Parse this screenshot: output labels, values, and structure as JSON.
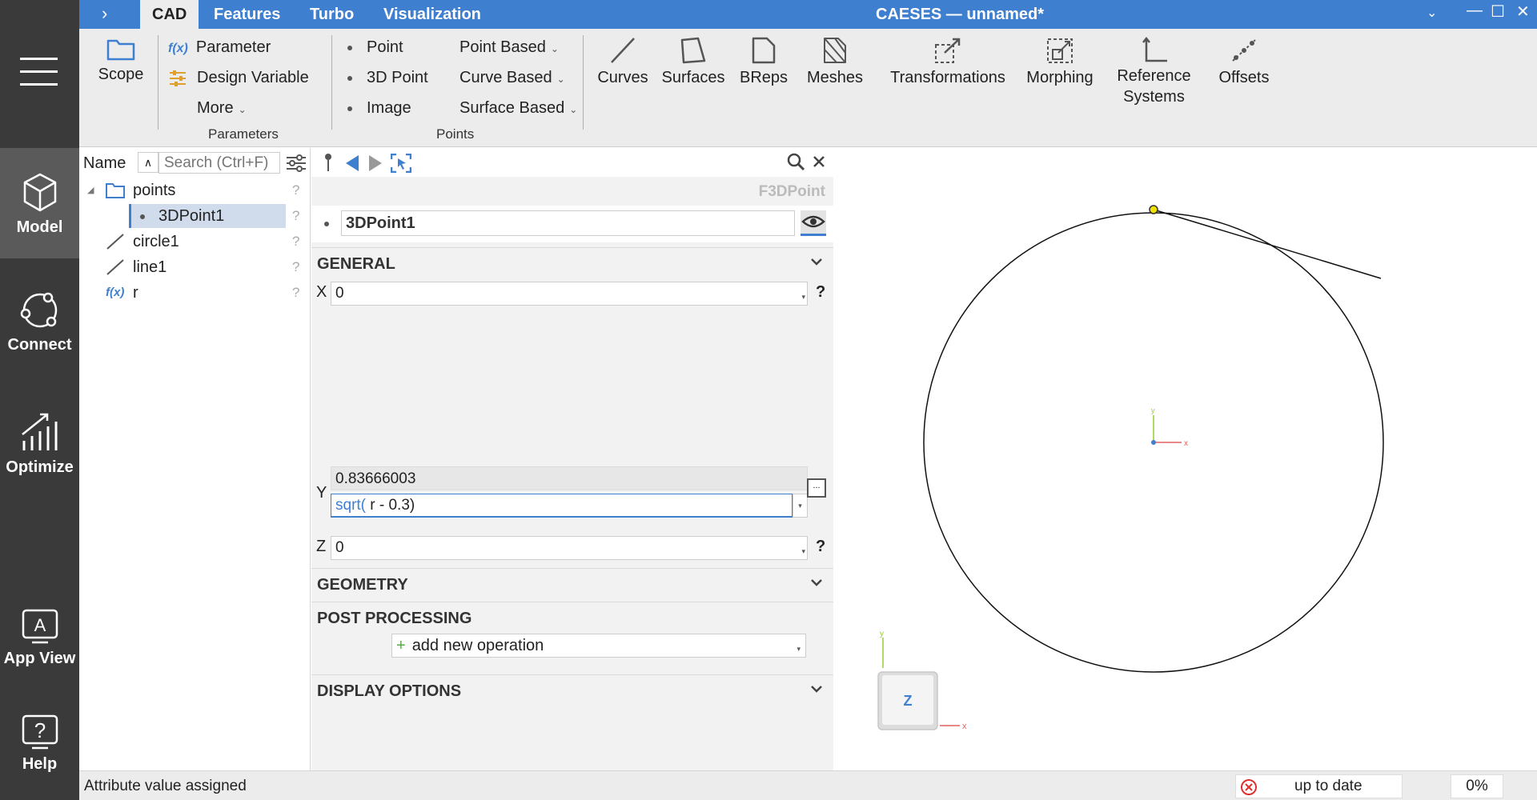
{
  "window": {
    "title": "CAESES — unnamed*",
    "controls": {
      "minimize": "—",
      "maximize": "☐",
      "close": "✕",
      "menu": "⌄"
    }
  },
  "tabs": [
    {
      "label": "CAD",
      "active": true
    },
    {
      "label": "Features",
      "active": false
    },
    {
      "label": "Turbo",
      "active": false
    },
    {
      "label": "Visualization",
      "active": false
    }
  ],
  "sidebar": {
    "items": [
      {
        "label": "Model",
        "icon": "cube-icon",
        "active": true
      },
      {
        "label": "Connect",
        "icon": "connect-icon",
        "active": false
      },
      {
        "label": "Optimize",
        "icon": "chart-icon",
        "active": false
      },
      {
        "label": "App View",
        "icon": "app-view-icon",
        "active": false
      },
      {
        "label": "Help",
        "icon": "help-icon",
        "active": false
      }
    ]
  },
  "ribbon": {
    "scope": "Scope",
    "parameters": {
      "items": [
        "Parameter",
        "Design Variable",
        "More"
      ],
      "group": "Parameters"
    },
    "points": {
      "items": [
        "Point",
        "3D Point",
        "Image"
      ],
      "based": [
        "Point Based",
        "Curve Based",
        "Surface Based"
      ],
      "group": "Points"
    },
    "big_buttons": [
      "Curves",
      "Surfaces",
      "BReps",
      "Meshes",
      "Transformations",
      "Morphing",
      "Reference",
      "Systems",
      "Offsets"
    ]
  },
  "tree": {
    "header": "Name",
    "search_placeholder": "Search (Ctrl+F)",
    "help": "?",
    "items": [
      {
        "label": "points",
        "icon": "folder-icon"
      },
      {
        "label": "3DPoint1",
        "icon": "point-icon"
      },
      {
        "label": "circle1",
        "icon": "curve-icon"
      },
      {
        "label": "line1",
        "icon": "curve-icon"
      },
      {
        "label": "r",
        "icon": "fx-icon"
      }
    ]
  },
  "properties": {
    "type": "F3DPoint",
    "name": "3DPoint1",
    "sections": {
      "general": "GENERAL",
      "geometry": "GEOMETRY",
      "post_processing": "POST PROCESSING",
      "display": "DISPLAY OPTIONS"
    },
    "x": {
      "label": "X",
      "value": "0"
    },
    "y": {
      "label": "Y",
      "result": "0.83666003",
      "fn": "sqrt(",
      "expr": " r - 0.3)"
    },
    "z": {
      "label": "Z",
      "value": "0"
    },
    "help": "?",
    "add_operation": "add new operation",
    "edit_ellipsis": "..."
  },
  "viewport": {
    "triad": {
      "x": "x",
      "y": "y",
      "z": "Z"
    },
    "colors": {
      "point": "#f0e000",
      "x_axis": "#e06060",
      "y_axis": "#9acd32",
      "z_axis": "#3f7fcf"
    }
  },
  "status": {
    "message": "Attribute value assigned",
    "state": "up to date",
    "progress": "0%"
  }
}
